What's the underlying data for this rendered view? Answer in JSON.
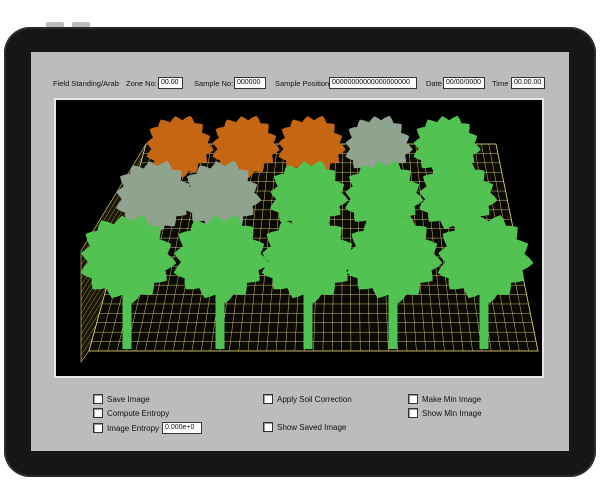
{
  "header": {
    "field_label": "Field Standing/Arab",
    "zone_label": "Zone No:",
    "zone_value": "00.00",
    "sample_label": "Sample No:",
    "sample_value": "000000",
    "position_label": "Sample Position",
    "position_value": "00000000000000000000",
    "date_label": "Date",
    "date_value": "00/00/0000",
    "time_label": "Time",
    "time_value": "00.00.00"
  },
  "options": {
    "save_image": "Save Image",
    "compute_entropy": "Compute Entropy",
    "image_entropy": "Image Entropy",
    "image_entropy_value": "0.000e+0",
    "apply_soil_correction": "Apply Soil Correction",
    "show_saved_image": "Show Saved Image",
    "make_min_image": "Make Min Image",
    "show_min_image": "Show Min Image"
  },
  "scene": {
    "grid_color": "#e0d27a",
    "colors": {
      "green": "#52c252",
      "gray": "#8fa38f",
      "orange": "#c46612"
    },
    "rows": [
      [
        "orange",
        "orange",
        "orange",
        "gray",
        "green"
      ],
      [
        "gray",
        "gray",
        "green",
        "green",
        "green"
      ],
      [
        "green",
        "green",
        "green",
        "green",
        "green"
      ]
    ]
  }
}
